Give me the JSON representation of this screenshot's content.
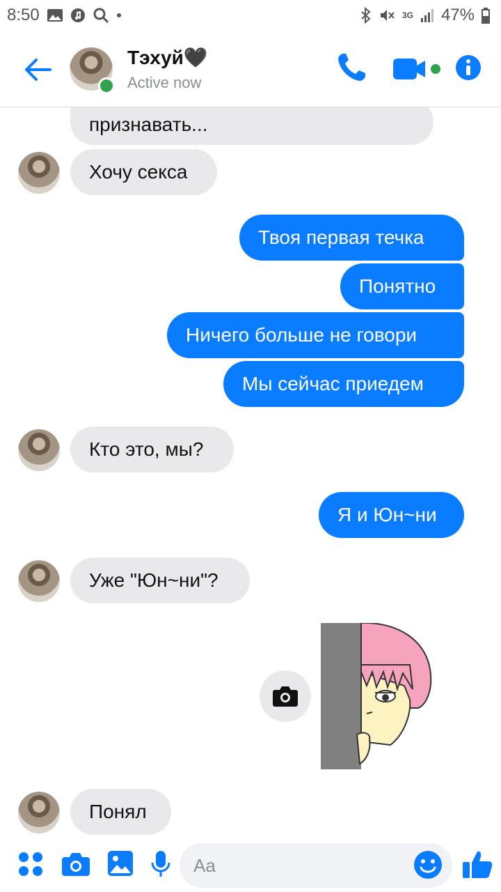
{
  "status_bar": {
    "time": "8:50",
    "network": "3G",
    "battery": "47%"
  },
  "header": {
    "name": "Тэхуй🖤",
    "status": "Active now"
  },
  "messages": [
    {
      "side": "in",
      "text": "признавать..."
    },
    {
      "side": "in",
      "text": "Хочу секса"
    },
    {
      "side": "out",
      "text": "Твоя первая течка"
    },
    {
      "side": "out",
      "text": "Понятно"
    },
    {
      "side": "out",
      "text": "Ничего больше не говори"
    },
    {
      "side": "out",
      "text": "Мы сейчас приедем"
    },
    {
      "side": "in",
      "text": "Кто это, мы?"
    },
    {
      "side": "out",
      "text": "Я и Юн~ни"
    },
    {
      "side": "in",
      "text": "Уже \"Юн~ни\"?"
    },
    {
      "side": "out",
      "type": "sticker",
      "sticker": "pink-haired-girl-peeking"
    },
    {
      "side": "in",
      "text": "Понял"
    }
  ],
  "composer": {
    "placeholder": "Aa"
  },
  "colors": {
    "accent": "#0a7cff",
    "incoming_bubble": "#e9e9eb",
    "online": "#31a24c"
  },
  "icons": [
    "back-arrow-icon",
    "phone-icon",
    "video-icon",
    "info-icon",
    "apps-icon",
    "camera-icon",
    "gallery-icon",
    "microphone-icon",
    "emoji-icon",
    "thumbs-up-icon"
  ]
}
